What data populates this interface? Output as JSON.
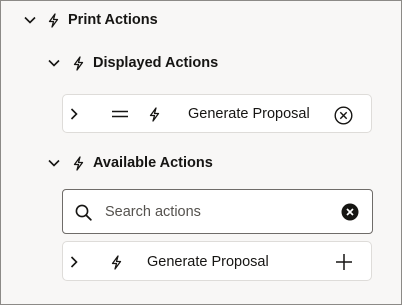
{
  "print_actions": {
    "title": "Print Actions",
    "displayed": {
      "title": "Displayed Actions",
      "items": [
        {
          "label": "Generate Proposal"
        }
      ]
    },
    "available": {
      "title": "Available Actions",
      "search": {
        "placeholder": "Search actions",
        "value": ""
      },
      "items": [
        {
          "label": "Generate Proposal"
        }
      ]
    }
  },
  "colors": {
    "text": "#161513",
    "card_border": "#dedcd9",
    "background": "#f8f7f6"
  },
  "icons": [
    "chevron-down-icon",
    "bolt-icon",
    "chevron-right-icon",
    "drag-handle-icon",
    "remove-icon",
    "search-icon",
    "clear-icon",
    "add-icon"
  ]
}
